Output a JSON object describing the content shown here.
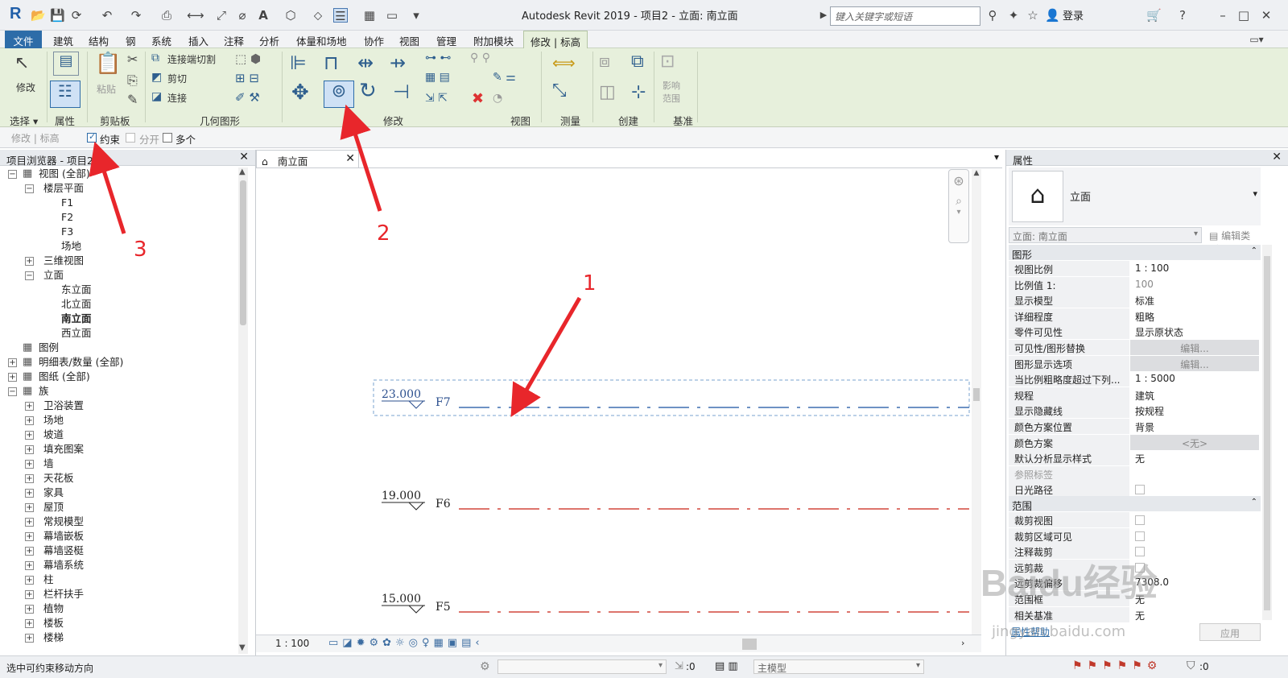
{
  "app": {
    "title": "Autodesk Revit 2019 - 项目2 - 立面: 南立面",
    "search_placeholder": "键入关键字或短语",
    "login": "登录",
    "logo": "R"
  },
  "menus": [
    "文件",
    "建筑",
    "结构",
    "钢",
    "系统",
    "插入",
    "注释",
    "分析",
    "体量和场地",
    "协作",
    "视图",
    "管理",
    "附加模块",
    "修改 | 标高"
  ],
  "ribbon": {
    "panels": [
      "选择",
      "属性",
      "剪贴板",
      "几何图形",
      "修改",
      "视图",
      "测量",
      "创建",
      "基准"
    ],
    "modify_label": "修改",
    "paste_label": "粘贴",
    "cut_end_label": "连接端切割",
    "cut_label": "剪切",
    "join_label": "连接",
    "influence_label": "影响范围"
  },
  "options": {
    "context": "修改 | 标高",
    "constrain": "约束",
    "split": "分开",
    "multiple": "多个",
    "constrain_checked": true
  },
  "browser": {
    "title": "项目浏览器 - 项目2",
    "items": [
      {
        "label": "视图 (全部)",
        "icon": "views-icon"
      },
      {
        "label": "楼层平面"
      },
      {
        "label": "F1"
      },
      {
        "label": "F2"
      },
      {
        "label": "F3"
      },
      {
        "label": "场地"
      },
      {
        "label": "三维视图"
      },
      {
        "label": "立面"
      },
      {
        "label": "东立面"
      },
      {
        "label": "北立面"
      },
      {
        "label": "南立面",
        "bold": true
      },
      {
        "label": "西立面"
      },
      {
        "label": "图例",
        "icon": "legend-icon"
      },
      {
        "label": "明细表/数量 (全部)",
        "icon": "schedule-icon"
      },
      {
        "label": "图纸 (全部)",
        "icon": "sheet-icon"
      },
      {
        "label": "族",
        "icon": "family-icon"
      },
      {
        "label": "卫浴装置"
      },
      {
        "label": "场地"
      },
      {
        "label": "坡道"
      },
      {
        "label": "填充图案"
      },
      {
        "label": "墙"
      },
      {
        "label": "天花板"
      },
      {
        "label": "家具"
      },
      {
        "label": "屋顶"
      },
      {
        "label": "常规模型"
      },
      {
        "label": "幕墙嵌板"
      },
      {
        "label": "幕墙竖梃"
      },
      {
        "label": "幕墙系统"
      },
      {
        "label": "柱"
      },
      {
        "label": "栏杆扶手"
      },
      {
        "label": "植物"
      },
      {
        "label": "楼板"
      },
      {
        "label": "楼梯"
      }
    ]
  },
  "view": {
    "tab": "南立面",
    "scale": "1 : 100",
    "levels": [
      {
        "elev": "23.000",
        "name": "F7",
        "selected": true
      },
      {
        "elev": "19.000",
        "name": "F6"
      },
      {
        "elev": "15.000",
        "name": "F5"
      }
    ]
  },
  "annotations": [
    "1",
    "2",
    "3"
  ],
  "props": {
    "title": "属性",
    "type": "立面",
    "selector": "立面: 南立面",
    "edit_type": "编辑类型",
    "sections": [
      "图形",
      "范围"
    ],
    "rows": [
      [
        "视图比例",
        "1 : 100"
      ],
      [
        "比例值 1:",
        "100"
      ],
      [
        "显示模型",
        "标准"
      ],
      [
        "详细程度",
        "粗略"
      ],
      [
        "零件可见性",
        "显示原状态"
      ],
      [
        "可见性/图形替换",
        "编辑..."
      ],
      [
        "图形显示选项",
        "编辑..."
      ],
      [
        "当比例粗略度超过下列...",
        "1 : 5000"
      ],
      [
        "规程",
        "建筑"
      ],
      [
        "显示隐藏线",
        "按规程"
      ],
      [
        "颜色方案位置",
        "背景"
      ],
      [
        "颜色方案",
        "<无>"
      ],
      [
        "默认分析显示样式",
        "无"
      ],
      [
        "参照标签",
        ""
      ],
      [
        "日光路径",
        ""
      ],
      [
        "裁剪视图",
        ""
      ],
      [
        "裁剪区域可见",
        ""
      ],
      [
        "注释裁剪",
        ""
      ],
      [
        "远剪裁",
        ""
      ],
      [
        "远剪裁偏移",
        "7308.0"
      ],
      [
        "范围框",
        "无"
      ],
      [
        "相关基准",
        "无"
      ]
    ],
    "help_link": "属性帮助",
    "apply": "应用"
  },
  "status": {
    "hint": "选中可约束移动方向",
    "zero": ":0",
    "model": "主模型",
    "filter": ":0"
  },
  "watermark": "Baidu经验",
  "watermark_url": "jingyan.baidu.com",
  "colors": {
    "accent": "#2d6ca8",
    "ribbon": "#e7f0dc",
    "arrow": "#e8262b",
    "level": "#2b4f8e",
    "dash_red": "#d2463c"
  }
}
